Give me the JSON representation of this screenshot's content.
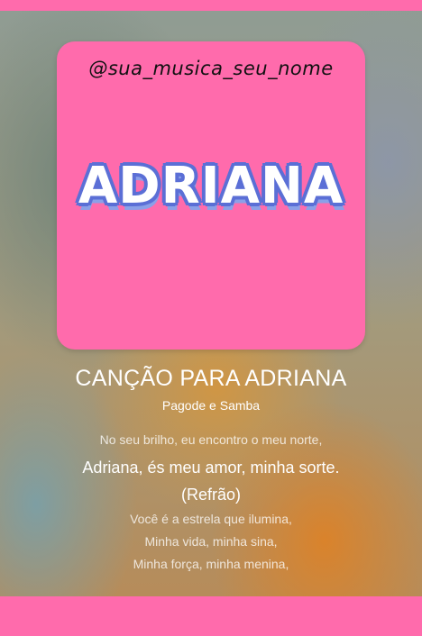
{
  "theme": {
    "accent": "#ff6bac",
    "name_outline": "#5b6fd6"
  },
  "cover": {
    "handle": "@sua_musica_seu_nome",
    "name": "ADRIANA"
  },
  "song": {
    "title": "CANÇÃO PARA ADRIANA",
    "genre": "Pagode e Samba"
  },
  "lyrics": [
    "No seu brilho, eu encontro o meu norte,",
    "Adriana, és meu amor, minha sorte.",
    "(Refrão)",
    "Você é a estrela que ilumina,",
    "Minha vida, minha sina,",
    "Minha força, minha menina,"
  ]
}
